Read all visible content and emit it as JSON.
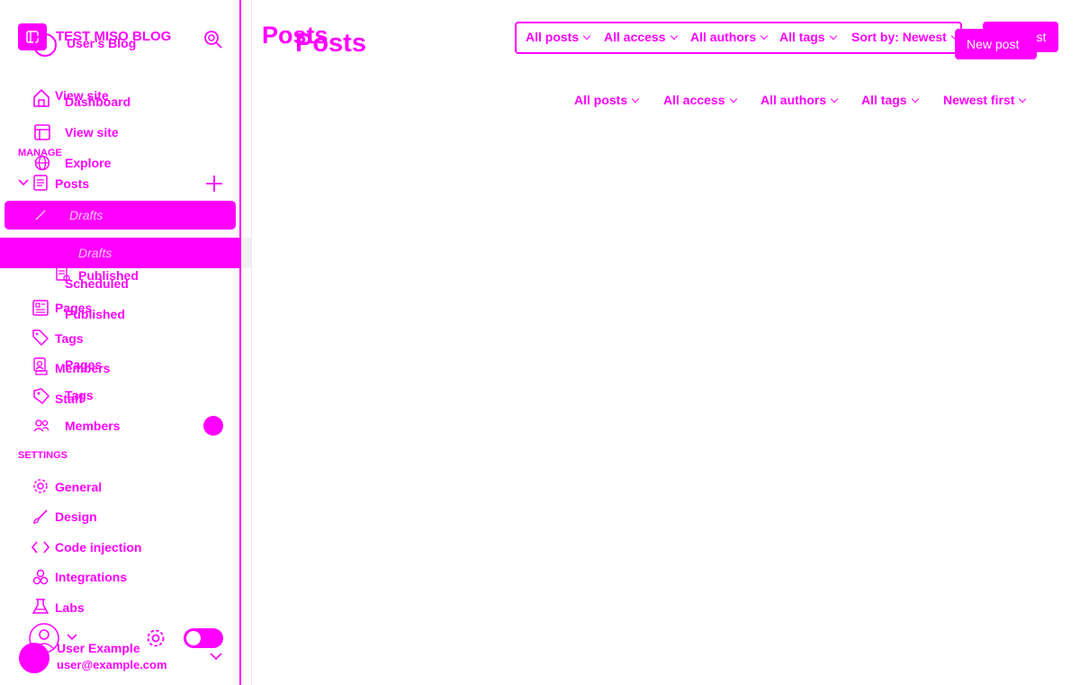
{
  "brand": {
    "blog_title": "TEST MISO BLOG",
    "blog_title_ghost": "User's Blog"
  },
  "sidebar": {
    "items_ghost": {
      "view_site": "View site",
      "dashboard": "Dashboard",
      "view_site_2": "View site",
      "explore": "Explore",
      "published_a": "Published",
      "scheduled": "Scheduled",
      "published_b": "Published",
      "pages_a": "Pages",
      "pages_b": "Pages",
      "tags_a": "Tags",
      "tags_b": "Tags",
      "members_a": "Members",
      "members_b": "Members",
      "staff": "Staff"
    },
    "manage_heading": "MANAGE",
    "posts_label": "Posts",
    "active_sub_a": "Drafts",
    "active_sub_b": "Drafts",
    "settings_heading": "SETTINGS",
    "settings_items": {
      "general": "General",
      "design": "Design",
      "code_injection": "Code injection",
      "integrations": "Integrations",
      "labs": "Labs"
    },
    "user": {
      "name": "User Example",
      "email": "user@example.com"
    }
  },
  "main": {
    "title_a": "Posts",
    "title_b": "Posts",
    "filters_top": {
      "posts": "All posts",
      "access": "All access",
      "authors": "All authors",
      "tags": "All tags",
      "sort": "Sort by: Newest"
    },
    "new_post_a": "New post",
    "new_post_b": "New post",
    "filters_bottom": {
      "posts": "All posts",
      "access": "All access",
      "authors": "All authors",
      "tags": "All tags",
      "sort": "Newest first"
    }
  },
  "colors": {
    "accent": "#ff00ff",
    "background": "#ffffff"
  }
}
